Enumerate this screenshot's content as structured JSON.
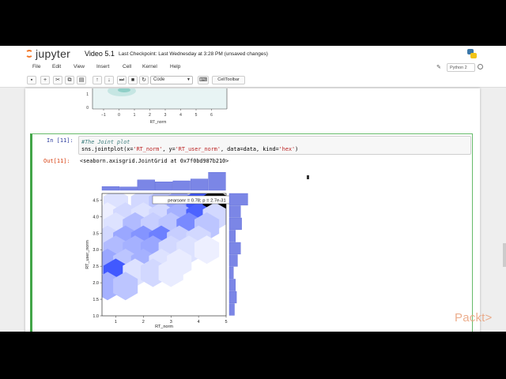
{
  "header": {
    "logo_text": "jupyter",
    "notebook_name": "Video 5.1",
    "checkpoint": "Last Checkpoint: Last Wednesday at 3:28 PM (unsaved changes)"
  },
  "menubar": {
    "items": [
      "File",
      "Edit",
      "View",
      "Insert",
      "Cell",
      "Kernel",
      "Help"
    ],
    "kernel": "Python 2"
  },
  "toolbar": {
    "cell_type": "Code",
    "celltoolbar_label": "CellToolbar"
  },
  "prev_output": {
    "x_ticks": [
      "−1",
      "0",
      "1",
      "2",
      "3",
      "4",
      "5",
      "6"
    ],
    "y_ticks": [
      "1",
      "0"
    ],
    "xlabel": "RT_norm"
  },
  "cell": {
    "in_prompt": "In [11]:",
    "code_line1": "#The Joint plot",
    "code_line2_pre": "sns.jointplot(x=",
    "code_str1": "'RT_norm'",
    "code_line2_mid1": ", y=",
    "code_str2": "'RT_user_norm'",
    "code_line2_mid2": ", data=data, kind=",
    "code_str3": "'hex'",
    "code_line2_end": ")",
    "out_prompt": "Out[11]:",
    "out_text": "<seaborn.axisgrid.JointGrid at 0x7f0bd987b210>"
  },
  "chart_data": {
    "type": "heatmap",
    "subtype": "hexbin-jointplot",
    "xlabel": "RT_norm",
    "ylabel": "RT_user_norm",
    "x_ticks": [
      1,
      2,
      3,
      4,
      5
    ],
    "y_ticks": [
      1.0,
      1.5,
      2.0,
      2.5,
      3.0,
      3.5,
      4.0,
      4.5
    ],
    "xlim": [
      0.5,
      5.0
    ],
    "ylim": [
      1.0,
      4.7
    ],
    "annotation": "pearsonr = 0.78; p = 2.7e-31",
    "color": "#1f3cff",
    "hexes": [
      {
        "x": 1.0,
        "y": 4.4,
        "level": 0.15
      },
      {
        "x": 2.0,
        "y": 4.4,
        "level": 0.2
      },
      {
        "x": 2.65,
        "y": 4.4,
        "level": 0.3
      },
      {
        "x": 3.3,
        "y": 4.4,
        "level": 0.45
      },
      {
        "x": 4.0,
        "y": 4.4,
        "level": 0.85
      },
      {
        "x": 4.6,
        "y": 4.4,
        "level": 1.0
      },
      {
        "x": 0.7,
        "y": 4.0,
        "level": 0.08
      },
      {
        "x": 1.35,
        "y": 4.0,
        "level": 0.2
      },
      {
        "x": 2.0,
        "y": 4.0,
        "level": 0.15
      },
      {
        "x": 2.65,
        "y": 4.0,
        "level": 0.2
      },
      {
        "x": 3.3,
        "y": 4.0,
        "level": 0.4
      },
      {
        "x": 4.0,
        "y": 4.0,
        "level": 0.8
      },
      {
        "x": 4.6,
        "y": 4.0,
        "level": 0.2
      },
      {
        "x": 1.0,
        "y": 3.7,
        "level": 0.15
      },
      {
        "x": 1.7,
        "y": 3.7,
        "level": 0.35
      },
      {
        "x": 2.35,
        "y": 3.7,
        "level": 0.25
      },
      {
        "x": 3.0,
        "y": 3.7,
        "level": 0.3
      },
      {
        "x": 3.65,
        "y": 3.7,
        "level": 0.6
      },
      {
        "x": 4.3,
        "y": 3.7,
        "level": 0.3
      },
      {
        "x": 0.7,
        "y": 3.3,
        "level": 0.2
      },
      {
        "x": 1.35,
        "y": 3.3,
        "level": 0.45
      },
      {
        "x": 2.0,
        "y": 3.3,
        "level": 0.55
      },
      {
        "x": 2.65,
        "y": 3.3,
        "level": 0.65
      },
      {
        "x": 3.3,
        "y": 3.3,
        "level": 0.25
      },
      {
        "x": 4.0,
        "y": 3.3,
        "level": 0.2
      },
      {
        "x": 1.0,
        "y": 3.0,
        "level": 0.35
      },
      {
        "x": 1.7,
        "y": 3.0,
        "level": 0.4
      },
      {
        "x": 2.35,
        "y": 3.0,
        "level": 0.45
      },
      {
        "x": 3.0,
        "y": 3.0,
        "level": 0.2
      },
      {
        "x": 3.65,
        "y": 3.0,
        "level": 0.15
      },
      {
        "x": 4.3,
        "y": 3.0,
        "level": 0.08
      },
      {
        "x": 0.7,
        "y": 2.6,
        "level": 0.45
      },
      {
        "x": 1.35,
        "y": 2.6,
        "level": 0.3
      },
      {
        "x": 2.0,
        "y": 2.6,
        "level": 0.4
      },
      {
        "x": 2.65,
        "y": 2.6,
        "level": 0.15
      },
      {
        "x": 3.3,
        "y": 2.6,
        "level": 0.1
      },
      {
        "x": 1.0,
        "y": 2.3,
        "level": 0.85
      },
      {
        "x": 1.7,
        "y": 2.3,
        "level": 0.15
      },
      {
        "x": 2.35,
        "y": 2.3,
        "level": 0.2
      },
      {
        "x": 3.0,
        "y": 2.3,
        "level": 0.1
      },
      {
        "x": 0.7,
        "y": 1.9,
        "level": 0.4
      },
      {
        "x": 1.35,
        "y": 1.9,
        "level": 0.3
      }
    ],
    "x_marginal": [
      0.2,
      0.18,
      0.55,
      0.45,
      0.5,
      0.6,
      0.95
    ],
    "y_marginal": [
      0.9,
      0.55,
      0.6,
      0.3,
      0.55,
      0.4,
      0.2,
      0.3,
      0.35,
      0.25
    ]
  }
}
